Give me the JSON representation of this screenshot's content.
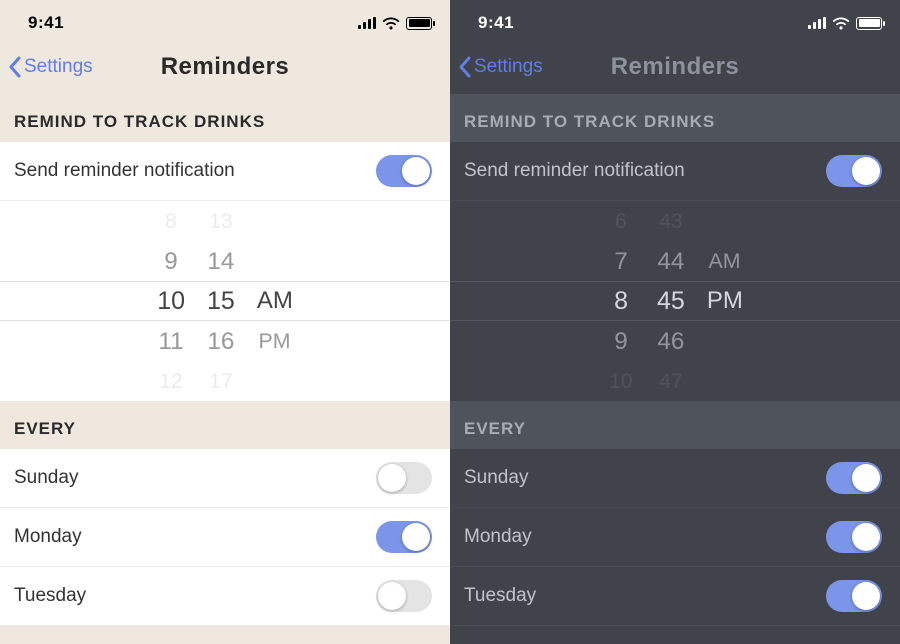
{
  "status": {
    "time": "9:41"
  },
  "nav": {
    "back_label": "Settings",
    "title": "Reminders"
  },
  "sections": {
    "remind_header": "REMIND TO TRACK DRINKS",
    "every_header": "EVERY"
  },
  "row_labels": {
    "send_reminder": "Send reminder notification"
  },
  "light": {
    "picker": {
      "hours": {
        "m2": "8",
        "m1": "9",
        "sel": "10",
        "p1": "11",
        "p2": "12"
      },
      "minutes": {
        "m2": "13",
        "m1": "14",
        "sel": "15",
        "p1": "16",
        "p2": "17"
      },
      "period": {
        "sel": "AM",
        "other": "PM"
      }
    },
    "toggles": {
      "send_reminder": true,
      "sunday": false,
      "monday": true,
      "tuesday": false
    }
  },
  "dark": {
    "picker": {
      "hours": {
        "m2": "6",
        "m1": "7",
        "sel": "8",
        "p1": "9",
        "p2": "10"
      },
      "minutes": {
        "m2": "43",
        "m1": "44",
        "sel": "45",
        "p1": "46",
        "p2": "47"
      },
      "period": {
        "sel": "PM",
        "other": "AM"
      }
    },
    "toggles": {
      "send_reminder": true,
      "sunday": true,
      "monday": true,
      "tuesday": true
    }
  },
  "days": {
    "sunday": "Sunday",
    "monday": "Monday",
    "tuesday": "Tuesday"
  },
  "colors": {
    "accent": "#7b95e8",
    "light_bg": "#eee8de",
    "dark_bg": "#40434a"
  }
}
